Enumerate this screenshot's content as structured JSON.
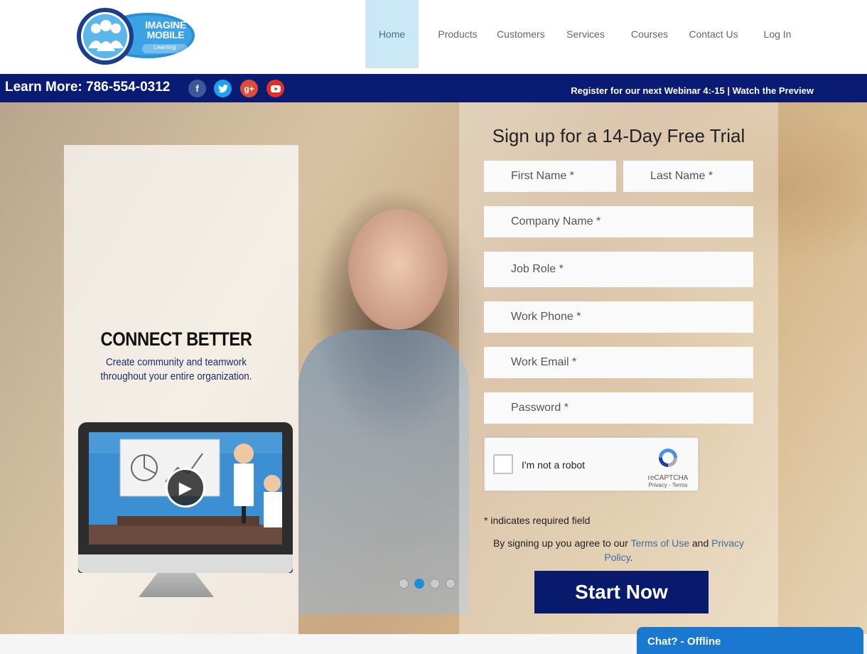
{
  "header": {
    "logo": {
      "line1": "IMAGINE",
      "line2": "MOBILE",
      "sub": "Learning"
    },
    "nav": [
      {
        "label": "Home",
        "active": true
      },
      {
        "label": "Products"
      },
      {
        "label": "Customers"
      },
      {
        "label": "Services"
      },
      {
        "label": "Courses"
      },
      {
        "label": "Contact Us"
      },
      {
        "label": "Log In"
      }
    ]
  },
  "topbar": {
    "learn_more": "Learn More: 786-554-0312",
    "social": [
      {
        "name": "facebook",
        "glyph": "f",
        "color": "#3b5998"
      },
      {
        "name": "twitter",
        "glyph": "t",
        "color": "#1da1f2"
      },
      {
        "name": "google-plus",
        "glyph": "g+",
        "color": "#dd4b39"
      },
      {
        "name": "youtube",
        "glyph": "▶",
        "color": "#e52d27"
      }
    ],
    "webinar_text": "Register for our next Webinar 4:-15",
    "divider": "|",
    "watch_preview": "Watch the Preview"
  },
  "hero": {
    "title": "CONNECT BETTER",
    "subtitle_line1": "Create community and teamwork",
    "subtitle_line2": "throughout your entire organization.",
    "slides": 4,
    "active_slide": 1
  },
  "form": {
    "title": "Sign up for a 14-Day Free Trial",
    "fields": {
      "first_name": "First Name *",
      "last_name": "Last Name *",
      "company": "Company Name *",
      "job_role": "Job Role *",
      "work_phone": "Work Phone *",
      "work_email": "Work Email *",
      "password": "Password *"
    },
    "captcha": {
      "label": "I'm not a robot",
      "brand": "reCAPTCHA",
      "links": "Privacy - Terms"
    },
    "required_note": "* indicates required field",
    "agree_prefix": "By signing up you agree to our",
    "terms": "Terms of Use",
    "and": "and",
    "privacy": "Privacy Policy",
    "period": ".",
    "submit": "Start Now"
  },
  "chat": {
    "label": "Chat? - Offline"
  }
}
